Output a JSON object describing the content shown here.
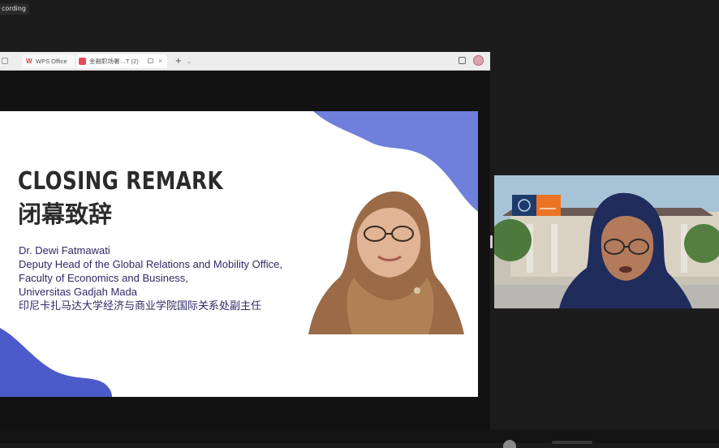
{
  "recording": {
    "label": "cording"
  },
  "browser": {
    "tabs": [
      {
        "label": "WPS Office"
      },
      {
        "label": "金融职场署…T (2)"
      }
    ],
    "new_tab": "+",
    "new_tab_menu": "⌄",
    "tab_close": "×"
  },
  "slide": {
    "title": "CLOSING REMARK",
    "title_cn": "闭幕致辞",
    "speaker_lines": [
      "Dr. Dewi Fatmawati",
      "Deputy Head of the Global Relations and Mobility Office,",
      "Faculty of Economics and Business,",
      "Universitas Gadjah Mada",
      "印尼卡扎马达大学经济与商业学院国际关系处副主任"
    ]
  },
  "colors": {
    "blob": "#6f7fdc",
    "blob_dark": "#4b5bc9",
    "speaker_text": "#2d2a66",
    "title_text": "#2b2b2b",
    "hijab": "#9a6b46",
    "video_hijab": "#1f2c5c"
  },
  "icons": {
    "wps": "wps-logo-icon",
    "doc": "document-icon",
    "reader": "reader-mode-icon",
    "avatar": "profile-avatar-icon"
  }
}
